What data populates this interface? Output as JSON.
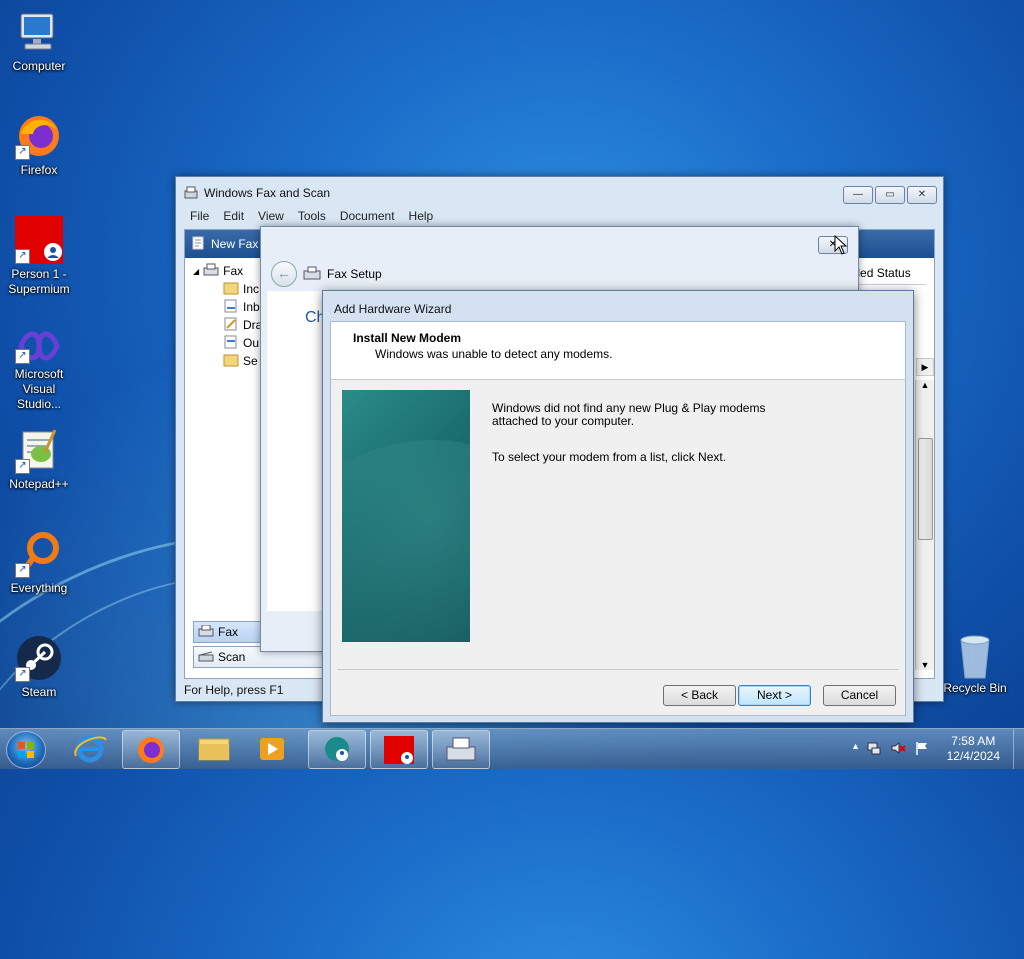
{
  "desktop": {
    "icons": [
      {
        "label": "Computer"
      },
      {
        "label": "Firefox"
      },
      {
        "label": "Person 1 - Supermium"
      },
      {
        "label": "Microsoft Visual Studio..."
      },
      {
        "label": "Notepad++"
      },
      {
        "label": "Everything"
      },
      {
        "label": "Steam"
      },
      {
        "label": "Recycle Bin"
      }
    ]
  },
  "fax_window": {
    "title": "Windows Fax and Scan",
    "menu": [
      "File",
      "Edit",
      "View",
      "Tools",
      "Document",
      "Help"
    ],
    "new_fax_label": "New Fax",
    "tree_root": "Fax",
    "tree_items": [
      "Inc",
      "Inb",
      "Dra",
      "Ou",
      "Se"
    ],
    "column_header": "ended Status",
    "bottom_tabs": [
      "Fax",
      "Scan"
    ],
    "status": "For Help, press F1",
    "btn_min": "—",
    "btn_max": "▭",
    "btn_close": "✕"
  },
  "fax_setup": {
    "title": "Fax Setup",
    "partial_heading": "Ch",
    "close_label": "✕"
  },
  "wizard": {
    "title": "Add Hardware Wizard",
    "heading": "Install New Modem",
    "subheading": "Windows was unable to detect any modems.",
    "line1": "Windows did not find any new Plug & Play modems",
    "line2": "attached to your computer.",
    "line3": "To select your modem from a list, click Next.",
    "back_label": "< Back",
    "next_label": "Next >",
    "cancel_label": "Cancel"
  },
  "taskbar": {
    "time": "7:58 AM",
    "date": "12/4/2024",
    "tray_chevron": "▲"
  }
}
